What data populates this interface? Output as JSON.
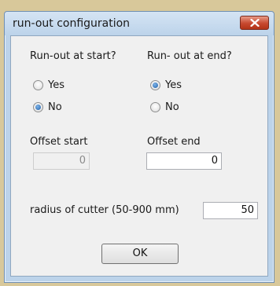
{
  "window": {
    "title": "run-out configuration"
  },
  "start": {
    "label": "Run-out at start?",
    "options": [
      {
        "label": "Yes",
        "selected": false
      },
      {
        "label": "No",
        "selected": true
      }
    ],
    "offset_label": "Offset start",
    "offset_value": "0",
    "offset_enabled": false
  },
  "end": {
    "label": "Run- out at end?",
    "options": [
      {
        "label": "Yes",
        "selected": true
      },
      {
        "label": "No",
        "selected": false
      }
    ],
    "offset_label": "Offset end",
    "offset_value": "0",
    "offset_enabled": true
  },
  "radius": {
    "label": "radius of cutter (50-900 mm)",
    "value": "50"
  },
  "ok_label": "OK",
  "icons": {
    "close": "close-icon"
  }
}
